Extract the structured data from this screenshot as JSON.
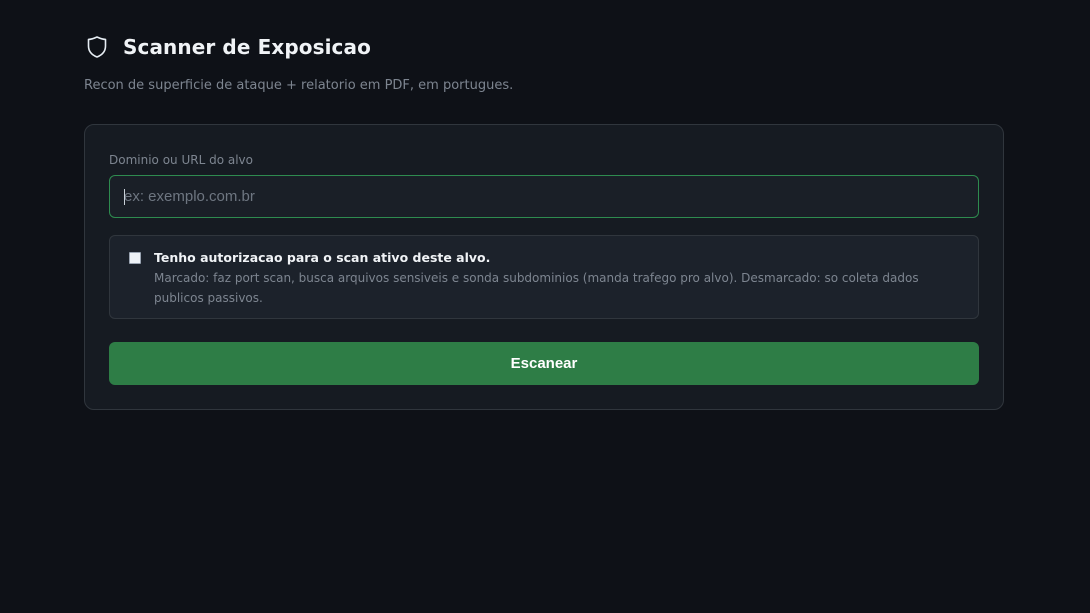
{
  "header": {
    "icon": "shield-icon",
    "title": "Scanner de Exposicao",
    "subtitle": "Recon de superficie de ataque + relatorio em PDF, em portugues."
  },
  "form": {
    "target_label": "Dominio ou URL do alvo",
    "target_placeholder": "ex: exemplo.com.br",
    "target_value": "",
    "authorization": {
      "checked": false,
      "title": "Tenho autorizacao para o scan ativo deste alvo.",
      "description": "Marcado: faz port scan, busca arquivos sensiveis e sonda subdominios (manda trafego pro alvo). Desmarcado: so coleta dados publicos passivos."
    },
    "submit_label": "Escanear"
  },
  "colors": {
    "background": "#0e1117",
    "card": "#161b22",
    "accent": "#2e7d46",
    "input_focus_border": "#2e8b4f"
  }
}
